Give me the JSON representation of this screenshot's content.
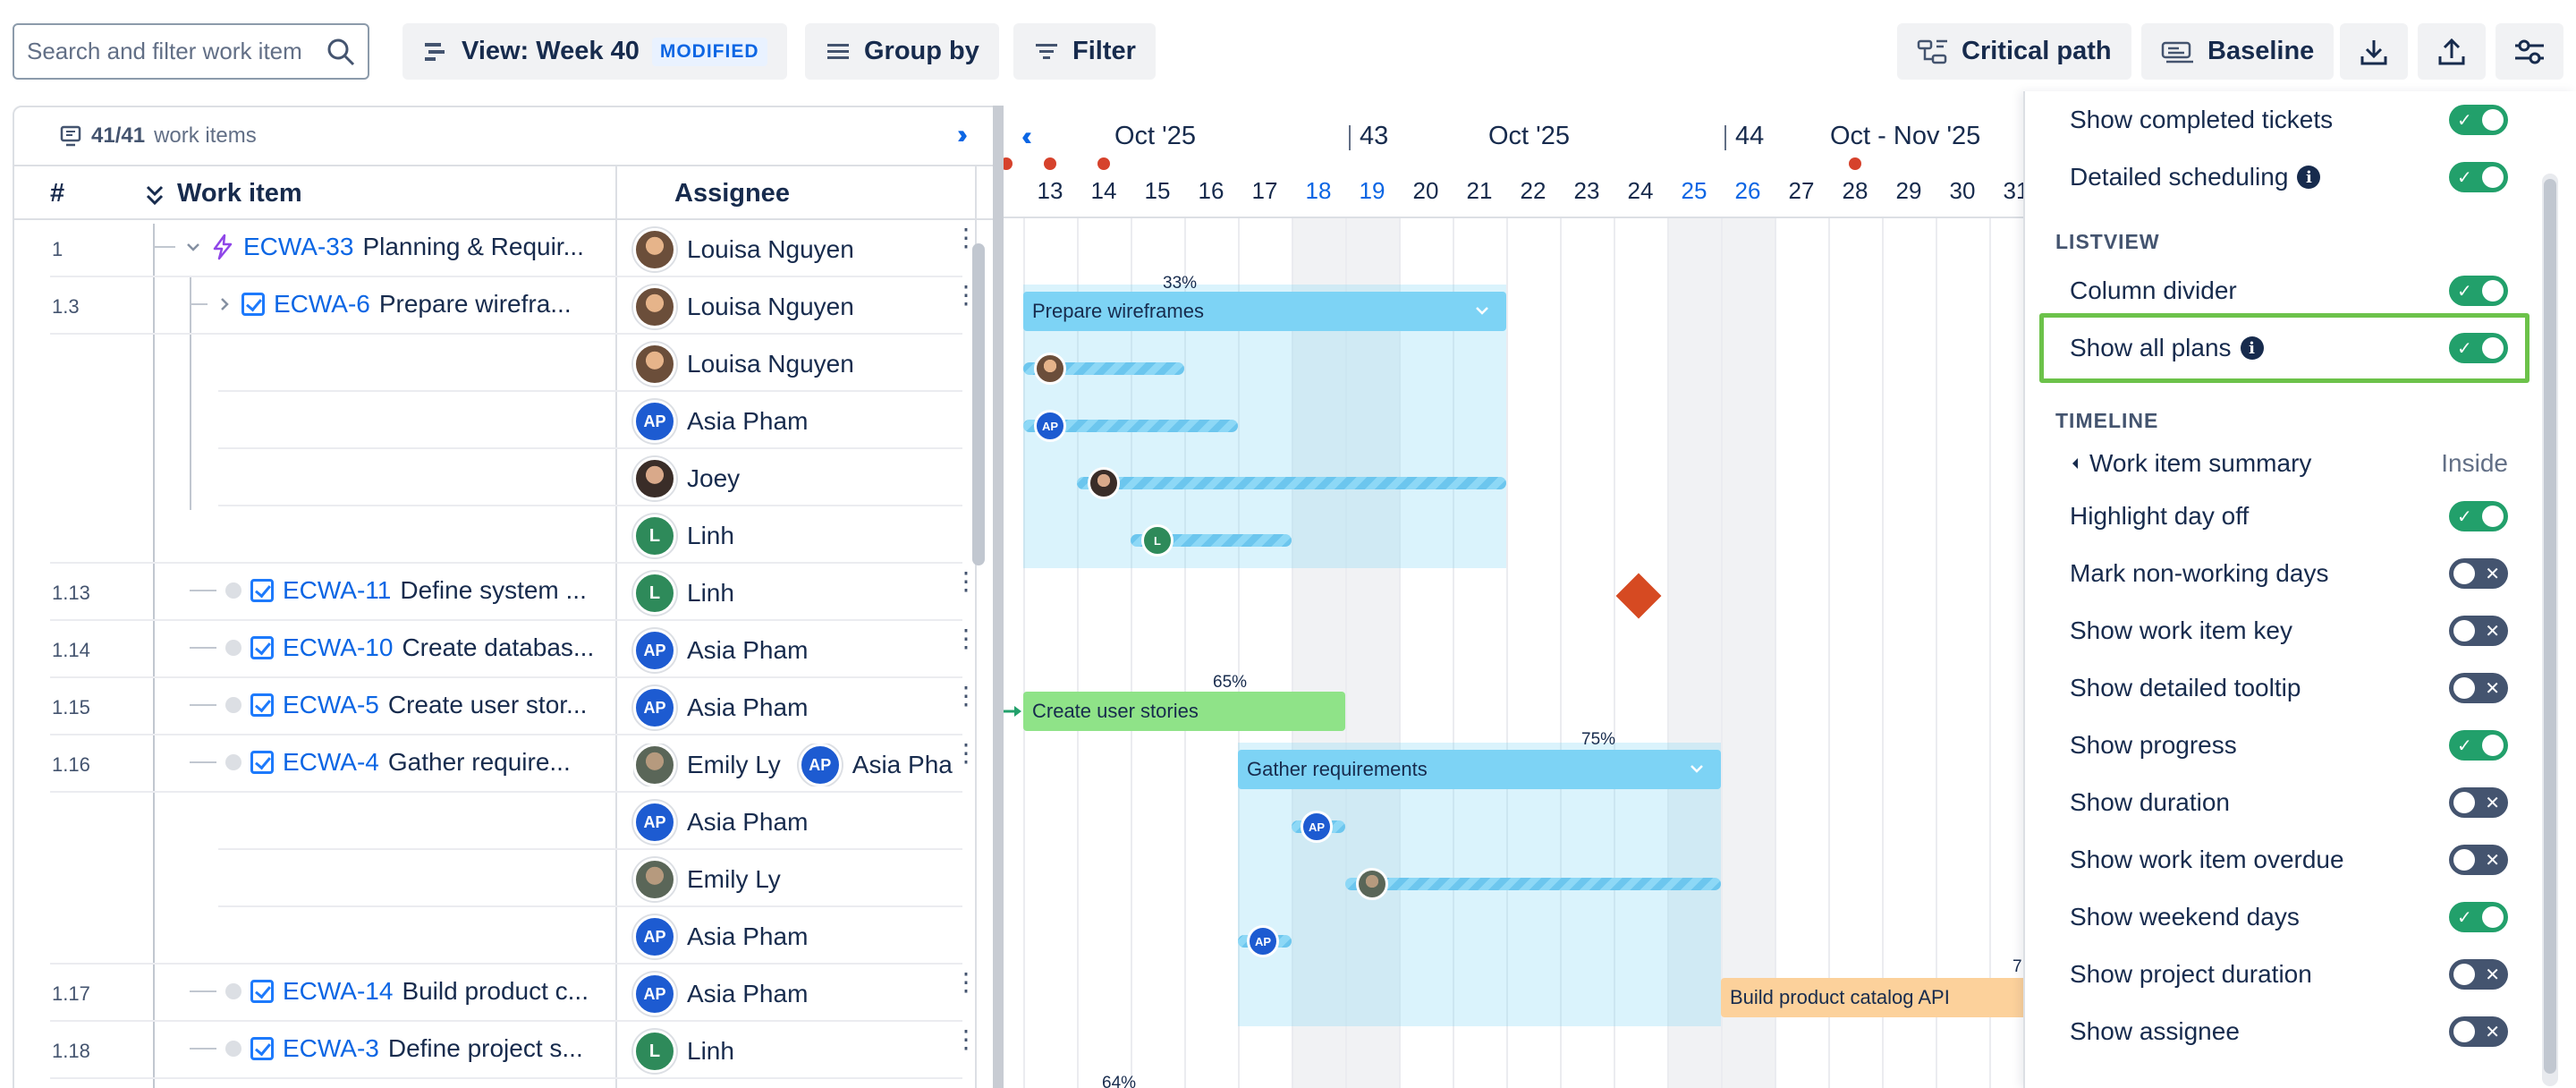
{
  "toolbar": {
    "search_placeholder": "Search and filter work item",
    "view_label": "View: Week 40",
    "view_badge": "MODIFIED",
    "group_by_label": "Group by",
    "filter_label": "Filter",
    "critical_path_label": "Critical path",
    "baseline_label": "Baseline"
  },
  "list": {
    "count_current": "41/41",
    "count_label": "work items",
    "columns": {
      "number": "#",
      "work_item": "Work item",
      "assignee": "Assignee"
    },
    "rows": [
      {
        "num": "1",
        "key": "ECWA-33",
        "title": "Planning & Requir...",
        "assignee": "Louisa Nguyen"
      },
      {
        "num": "1.3",
        "key": "ECWA-6",
        "title": "Prepare wirefra...",
        "assignee": "Louisa Nguyen"
      },
      {
        "num": "",
        "key": "",
        "title": "",
        "assignee": "Louisa Nguyen"
      },
      {
        "num": "",
        "key": "",
        "title": "",
        "assignee": "Asia Pham"
      },
      {
        "num": "",
        "key": "",
        "title": "",
        "assignee": "Joey"
      },
      {
        "num": "",
        "key": "",
        "title": "",
        "assignee": "Linh"
      },
      {
        "num": "1.13",
        "key": "ECWA-11",
        "title": "Define system ...",
        "assignee": "Linh"
      },
      {
        "num": "1.14",
        "key": "ECWA-10",
        "title": "Create databas...",
        "assignee": "Asia Pham"
      },
      {
        "num": "1.15",
        "key": "ECWA-5",
        "title": "Create user stor...",
        "assignee": "Asia Pham"
      },
      {
        "num": "1.16",
        "key": "ECWA-4",
        "title": "Gather require...",
        "assignee": "Emily Ly",
        "assignee2": "Asia Pha"
      },
      {
        "num": "",
        "key": "",
        "title": "",
        "assignee": "Asia Pham"
      },
      {
        "num": "",
        "key": "",
        "title": "",
        "assignee": "Emily Ly"
      },
      {
        "num": "",
        "key": "",
        "title": "",
        "assignee": "Asia Pham"
      },
      {
        "num": "1.17",
        "key": "ECWA-14",
        "title": "Build product c...",
        "assignee": "Asia Pham"
      },
      {
        "num": "1.18",
        "key": "ECWA-3",
        "title": "Define project s...",
        "assignee": "Linh"
      }
    ],
    "avatar_initials": {
      "ap": "AP",
      "l": "L"
    }
  },
  "timeline": {
    "months": [
      "Oct '25",
      "Oct '25",
      "Oct - Nov '25"
    ],
    "weeks": [
      "43",
      "44"
    ],
    "partial_prefix": "2",
    "days": [
      "13",
      "14",
      "15",
      "16",
      "17",
      "18",
      "19",
      "20",
      "21",
      "22",
      "23",
      "24",
      "25",
      "26",
      "27",
      "28",
      "29",
      "30",
      "31"
    ],
    "bars": {
      "prepare": {
        "label": "Prepare wireframes",
        "progress": "33%"
      },
      "user_stories": {
        "label": "Create user stories",
        "progress": "65%"
      },
      "gather": {
        "label": "Gather requirements",
        "progress": "75%"
      },
      "catalog": {
        "label": "Build product catalog API",
        "progress": "7"
      },
      "bottom_progress": "64%"
    }
  },
  "settings": {
    "top_items": [
      {
        "label": "Show completed tickets",
        "on": true
      },
      {
        "label": "Detailed scheduling",
        "on": true
      }
    ],
    "listview_title": "LISTVIEW",
    "listview_items": [
      {
        "label": "Column divider",
        "on": true
      },
      {
        "label": "Show all plans",
        "on": true
      }
    ],
    "timeline_title": "TIMELINE",
    "summary_label": "Work item summary",
    "summary_value": "Inside",
    "timeline_items": [
      {
        "label": "Highlight day off",
        "on": true
      },
      {
        "label": "Mark non-working days",
        "on": false
      },
      {
        "label": "Show work item key",
        "on": false
      },
      {
        "label": "Show detailed tooltip",
        "on": false
      },
      {
        "label": "Show progress",
        "on": true
      },
      {
        "label": "Show duration",
        "on": false
      },
      {
        "label": "Show work item overdue",
        "on": false
      },
      {
        "label": "Show weekend days",
        "on": true
      },
      {
        "label": "Show project duration",
        "on": false
      },
      {
        "label": "Show assignee",
        "on": false
      }
    ],
    "info_glyph": "i"
  },
  "colors": {
    "accent": "#0c66e4",
    "toggle_on": "#22a06b",
    "toggle_off": "#44546f",
    "highlight": "#6cc24a"
  }
}
